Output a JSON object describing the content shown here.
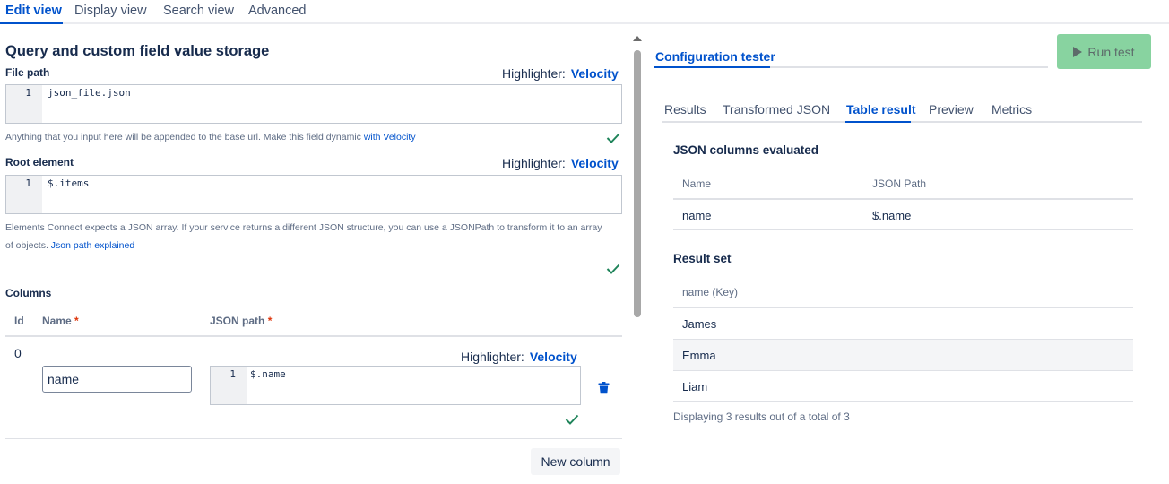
{
  "top_tabs": [
    {
      "label": "Edit view",
      "active": true
    },
    {
      "label": "Display view",
      "active": false
    },
    {
      "label": "Search view",
      "active": false
    },
    {
      "label": "Advanced",
      "active": false
    }
  ],
  "left": {
    "title": "Query and custom field value storage",
    "file_path": {
      "label": "File path",
      "highlighter_label": "Highlighter:",
      "highlighter_value": "Velocity",
      "line_number": "1",
      "code": "json_file.json",
      "help_text": "Anything that you input here will be appended to the base url. Make this field dynamic ",
      "help_link": "with Velocity"
    },
    "root_element": {
      "label": "Root element",
      "highlighter_label": "Highlighter:",
      "highlighter_value": "Velocity",
      "line_number": "1",
      "code": "$.items",
      "help_text_1": "Elements Connect expects a JSON array. If your service returns a different JSON structure, you can use a JSONPath to transform it to an array",
      "help_text_2": "of objects. ",
      "help_link": "Json path explained"
    },
    "columns": {
      "label": "Columns",
      "headers": {
        "id": "Id",
        "name": "Name",
        "json_path": "JSON path",
        "required_mark": "*"
      },
      "rows": [
        {
          "id": "0",
          "name_value": "name",
          "highlighter_label": "Highlighter:",
          "highlighter_value": "Velocity",
          "line_number": "1",
          "code": "$.name"
        }
      ],
      "new_column_label": "New column"
    }
  },
  "right": {
    "title": "Configuration tester",
    "run_label": "Run test",
    "tabs": [
      {
        "label": "Results",
        "active": false
      },
      {
        "label": "Transformed JSON",
        "active": false
      },
      {
        "label": "Table result",
        "active": true
      },
      {
        "label": "Preview",
        "active": false
      },
      {
        "label": "Metrics",
        "active": false
      }
    ],
    "json_columns": {
      "heading": "JSON columns evaluated",
      "headers": [
        "Name",
        "JSON Path"
      ],
      "rows": [
        [
          "name",
          "$.name"
        ]
      ]
    },
    "result_set": {
      "heading": "Result set",
      "header": "name (Key)",
      "rows": [
        "James",
        "Emma",
        "Liam"
      ],
      "footer": "Displaying 3 results out of a total of 3"
    }
  },
  "colors": {
    "accent": "#0052cc",
    "success": "#1f845a",
    "run_button": "#88d3a0",
    "required": "#de350b"
  },
  "icons": {
    "check": "check-icon",
    "trash": "trash-icon",
    "play": "play-icon"
  }
}
